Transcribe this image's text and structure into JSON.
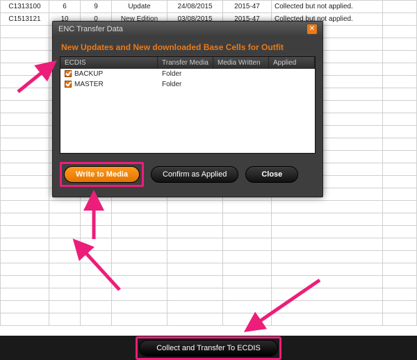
{
  "grid": {
    "rows": [
      {
        "c0": "C1313100",
        "c1": "6",
        "c2": "9",
        "c3": "Update",
        "c4": "24/08/2015",
        "c5": "2015-47",
        "c6": "Collected but not applied."
      },
      {
        "c0": "C1513121",
        "c1": "10",
        "c2": "0",
        "c3": "New Edition",
        "c4": "03/08/2015",
        "c5": "2015-47",
        "c6": "Collected but not applied."
      }
    ]
  },
  "bottom": {
    "collect_label": "Collect and Transfer To ECDIS"
  },
  "dialog": {
    "title": "ENC Transfer Data",
    "subtitle": "New Updates and New downloaded Base Cells for Outfit",
    "headers": {
      "ecdis": "ECDIS",
      "media": "Transfer Media",
      "written": "Media Written",
      "applied": "Applied"
    },
    "rows": [
      {
        "name": "BACKUP",
        "media": "Folder",
        "written": "",
        "applied": ""
      },
      {
        "name": "MASTER",
        "media": "Folder",
        "written": "",
        "applied": ""
      }
    ],
    "buttons": {
      "write": "Write to Media",
      "confirm": "Confirm as Applied",
      "close": "Close"
    },
    "close_glyph": "✕"
  },
  "arrow_color": "#ec1e79"
}
